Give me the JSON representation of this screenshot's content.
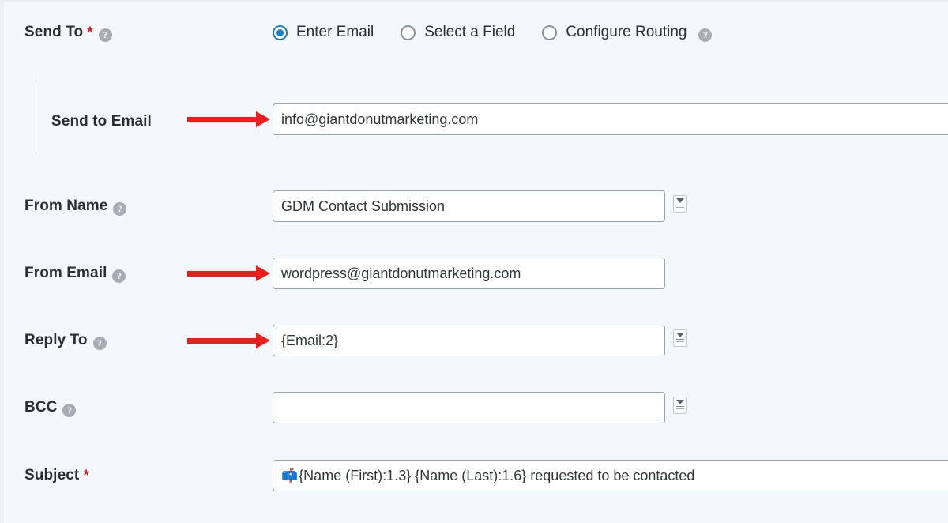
{
  "form": {
    "send_to": {
      "label": "Send To",
      "required_mark": "*",
      "help_icon": "question-mark-icon",
      "options": [
        {
          "label": "Enter Email",
          "selected": true
        },
        {
          "label": "Select a Field",
          "selected": false
        },
        {
          "label": "Configure Routing",
          "selected": false,
          "help_icon": "question-mark-icon"
        }
      ]
    },
    "send_to_email": {
      "label": "Send to Email",
      "value": "info@giantdonutmarketing.com",
      "has_arrow": true,
      "has_merge_tag": false
    },
    "from_name": {
      "label": "From Name",
      "help_icon": "question-mark-icon",
      "value": "GDM Contact Submission",
      "has_arrow": false,
      "has_merge_tag": true
    },
    "from_email": {
      "label": "From Email",
      "help_icon": "question-mark-icon",
      "value": "wordpress@giantdonutmarketing.com",
      "has_arrow": true,
      "has_merge_tag": false
    },
    "reply_to": {
      "label": "Reply To",
      "help_icon": "question-mark-icon",
      "value": "{Email:2}",
      "has_arrow": true,
      "has_merge_tag": true
    },
    "bcc": {
      "label": "BCC",
      "help_icon": "question-mark-icon",
      "value": "",
      "placeholder": "",
      "has_arrow": false,
      "has_merge_tag": true
    },
    "subject": {
      "label": "Subject",
      "required_mark": "*",
      "emoji": "📫",
      "value": "{Name (First):1.3} {Name (Last):1.6} requested to be contacted",
      "has_arrow": false,
      "has_merge_tag": false
    }
  },
  "colors": {
    "background": "#f4f7fb",
    "accent_radio": "#1484c4",
    "required": "#c0202a",
    "arrow": "#ee1d1d",
    "label_text": "#2b2f33",
    "input_border": "#9aa2ab"
  }
}
